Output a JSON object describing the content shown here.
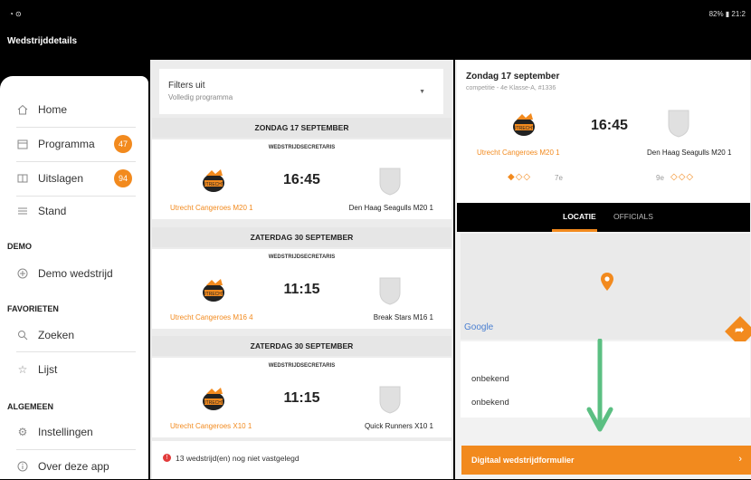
{
  "status_bar": {
    "left_icons": "◔ ⊙",
    "right": "82% ▮ 21:2"
  },
  "app_bar": {
    "title": "Wedstrijddetails"
  },
  "sidebar": {
    "items": [
      {
        "label": "Home",
        "icon": "home-icon"
      },
      {
        "label": "Programma",
        "icon": "calendar-icon",
        "badge": "47"
      },
      {
        "label": "Uitslagen",
        "icon": "scoreboard-icon",
        "badge": "94"
      },
      {
        "label": "Stand",
        "icon": "list-icon"
      }
    ],
    "sections": [
      {
        "heading": "DEMO",
        "items": [
          {
            "label": "Demo wedstrijd",
            "icon": "plus-circle-icon"
          }
        ]
      },
      {
        "heading": "FAVORIETEN",
        "items": [
          {
            "label": "Zoeken",
            "icon": "search-icon"
          },
          {
            "label": "Lijst",
            "icon": "star-icon"
          }
        ]
      },
      {
        "heading": "ALGEMEEN",
        "items": [
          {
            "label": "Instellingen",
            "icon": "gear-icon"
          },
          {
            "label": "Over deze app",
            "icon": "info-icon"
          }
        ]
      }
    ]
  },
  "filter": {
    "title": "Filters uit",
    "subtitle": "Volledig programma"
  },
  "days": [
    {
      "date": "ZONDAG 17 SEPTEMBER",
      "secretary": "WEDSTRIJDSECRETARIS",
      "time": "16:45",
      "home": "Utrecht Cangeroes M20 1",
      "away": "Den Haag Seagulls M20 1"
    },
    {
      "date": "ZATERDAG 30 SEPTEMBER",
      "secretary": "WEDSTRIJDSECRETARIS",
      "time": "11:15",
      "home": "Utrecht Cangeroes M16 4",
      "away": "Break Stars M16 1"
    },
    {
      "date": "ZATERDAG 30 SEPTEMBER",
      "secretary": "WEDSTRIJDSECRETARIS",
      "time": "11:15",
      "home": "Utrecht Cangeroes X10 1",
      "away": "Quick Runners X10 1"
    }
  ],
  "notice": {
    "text": "13 wedstrijd(en) nog niet vastgelegd",
    "icon": "!"
  },
  "detail": {
    "date": "Zondag 17 september",
    "competition": "competitie - 4e Klasse-A, #1336",
    "time": "16:45",
    "home": "Utrecht Cangeroes M20 1",
    "away": "Den Haag Seagulls M20 1",
    "home_form": "◆◇◇",
    "home_rank": "7e",
    "away_rank": "9e",
    "away_form": "◇◇◇"
  },
  "tabs": {
    "locatie": "LOCATIE",
    "officials": "OFFICIALS"
  },
  "map": {
    "brand": "Google"
  },
  "info": {
    "row1": "onbekend",
    "row2": "onbekend"
  },
  "form_button": {
    "label": "Digitaal wedstrijdformulier",
    "chevron": "›"
  },
  "logo_text": "UTRECHT",
  "colors": {
    "accent": "#f28a1e",
    "arrow": "#5bbf82"
  }
}
